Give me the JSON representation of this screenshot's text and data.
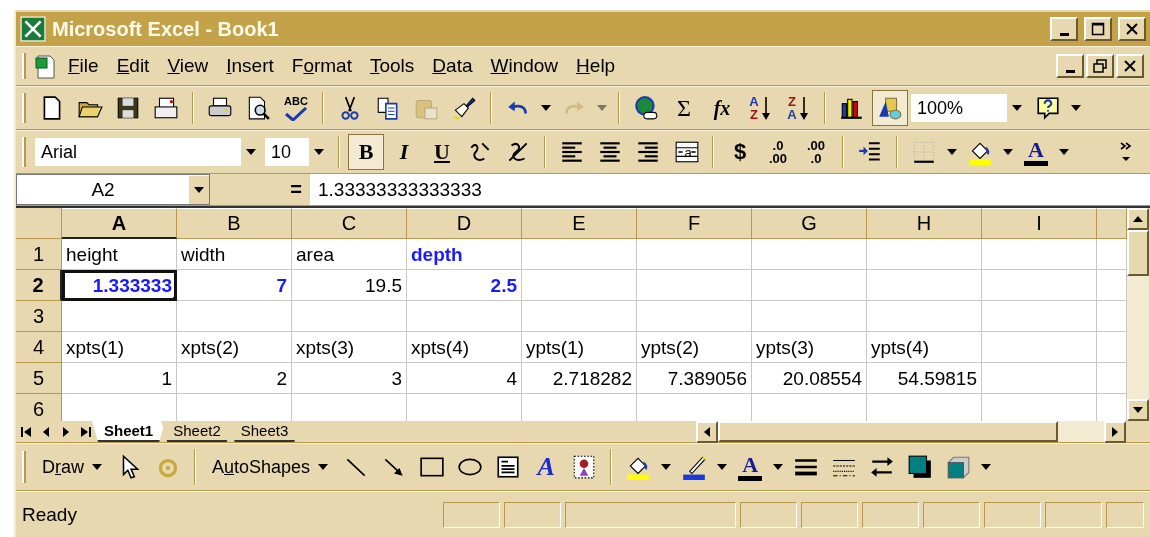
{
  "window": {
    "title": "Microsoft Excel - Book1"
  },
  "menu": [
    {
      "key": "F",
      "post": "ile"
    },
    {
      "key": "E",
      "post": "dit"
    },
    {
      "key": "V",
      "post": "iew"
    },
    {
      "key": "I",
      "post": "nsert"
    },
    {
      "pre": "F",
      "key": "o",
      "post": "rmat"
    },
    {
      "key": "T",
      "post": "ools"
    },
    {
      "key": "D",
      "post": "ata"
    },
    {
      "key": "W",
      "post": "indow"
    },
    {
      "key": "H",
      "post": "elp"
    }
  ],
  "standard_toolbar": {
    "spelling_label": "ABC",
    "paste_enabled": false,
    "redo_enabled": false,
    "autosum_label": "Σ",
    "function_label": "fx",
    "sort_ascending": [
      "A",
      "Z"
    ],
    "sort_descending": [
      "Z",
      "A"
    ],
    "drawing_pressed": true,
    "zoom": "100%"
  },
  "formatting_toolbar": {
    "font": "Arial",
    "size": "10",
    "bold": {
      "label": "B",
      "pressed": true
    },
    "italic": {
      "label": "I",
      "pressed": false
    },
    "underline": {
      "label": "U",
      "pressed": false
    },
    "merge_label": "a",
    "currency_label": "$",
    "increase_decimal": [
      ".0",
      ".00"
    ],
    "decrease_decimal": [
      ".00",
      ".0"
    ],
    "font_color_label": "A"
  },
  "formula_bar": {
    "name_box": "A2",
    "equals": "=",
    "formula": "1.33333333333333"
  },
  "columns": [
    {
      "label": "A",
      "selected": true
    },
    {
      "label": "B",
      "selected": false
    },
    {
      "label": "C",
      "selected": false
    },
    {
      "label": "D",
      "selected": false
    },
    {
      "label": "E",
      "selected": false
    },
    {
      "label": "F",
      "selected": false
    },
    {
      "label": "G",
      "selected": false
    },
    {
      "label": "H",
      "selected": false
    },
    {
      "label": "I",
      "selected": false
    }
  ],
  "rows": [
    {
      "label": "1",
      "selected": false,
      "cells": [
        {
          "text": "height",
          "kind": "text",
          "emphasis": false
        },
        {
          "text": "width",
          "kind": "text",
          "emphasis": false
        },
        {
          "text": "area",
          "kind": "text",
          "emphasis": false
        },
        {
          "text": "depth",
          "kind": "text",
          "emphasis": true
        },
        null,
        null,
        null,
        null,
        null
      ]
    },
    {
      "label": "2",
      "selected": true,
      "cells": [
        {
          "text": "1.333333",
          "kind": "number",
          "emphasis": true,
          "active": true
        },
        {
          "text": "7",
          "kind": "number",
          "emphasis": true
        },
        {
          "text": "19.5",
          "kind": "number",
          "emphasis": false
        },
        {
          "text": "2.5",
          "kind": "number",
          "emphasis": true
        },
        null,
        null,
        null,
        null,
        null
      ]
    },
    {
      "label": "3",
      "selected": false,
      "cells": [
        null,
        null,
        null,
        null,
        null,
        null,
        null,
        null,
        null
      ]
    },
    {
      "label": "4",
      "selected": false,
      "cells": [
        {
          "text": "xpts(1)",
          "kind": "text",
          "emphasis": false
        },
        {
          "text": "xpts(2)",
          "kind": "text",
          "emphasis": false
        },
        {
          "text": "xpts(3)",
          "kind": "text",
          "emphasis": false
        },
        {
          "text": "xpts(4)",
          "kind": "text",
          "emphasis": false
        },
        {
          "text": "ypts(1)",
          "kind": "text",
          "emphasis": false
        },
        {
          "text": "ypts(2)",
          "kind": "text",
          "emphasis": false
        },
        {
          "text": "ypts(3)",
          "kind": "text",
          "emphasis": false
        },
        {
          "text": "ypts(4)",
          "kind": "text",
          "emphasis": false
        },
        null
      ]
    },
    {
      "label": "5",
      "selected": false,
      "cells": [
        {
          "text": "1",
          "kind": "number",
          "emphasis": false
        },
        {
          "text": "2",
          "kind": "number",
          "emphasis": false
        },
        {
          "text": "3",
          "kind": "number",
          "emphasis": false
        },
        {
          "text": "4",
          "kind": "number",
          "emphasis": false
        },
        {
          "text": "2.718282",
          "kind": "number",
          "emphasis": false
        },
        {
          "text": "7.389056",
          "kind": "number",
          "emphasis": false
        },
        {
          "text": "20.08554",
          "kind": "number",
          "emphasis": false
        },
        {
          "text": "54.59815",
          "kind": "number",
          "emphasis": false
        },
        null
      ]
    },
    {
      "label": "6",
      "selected": false,
      "cells": [
        null,
        null,
        null,
        null,
        null,
        null,
        null,
        null,
        null
      ]
    }
  ],
  "sheet_tabs": [
    {
      "label": "Sheet1",
      "selected": true
    },
    {
      "label": "Sheet2",
      "selected": false
    },
    {
      "label": "Sheet3",
      "selected": false
    }
  ],
  "drawing_toolbar": {
    "draw": {
      "pre": "D",
      "key": "r",
      "post": "aw"
    },
    "autoshapes": {
      "pre": "A",
      "key": "u",
      "post": "toShapes"
    },
    "wordart_label": "A",
    "font_color_label": "A"
  },
  "status_bar": {
    "text": "Ready"
  }
}
